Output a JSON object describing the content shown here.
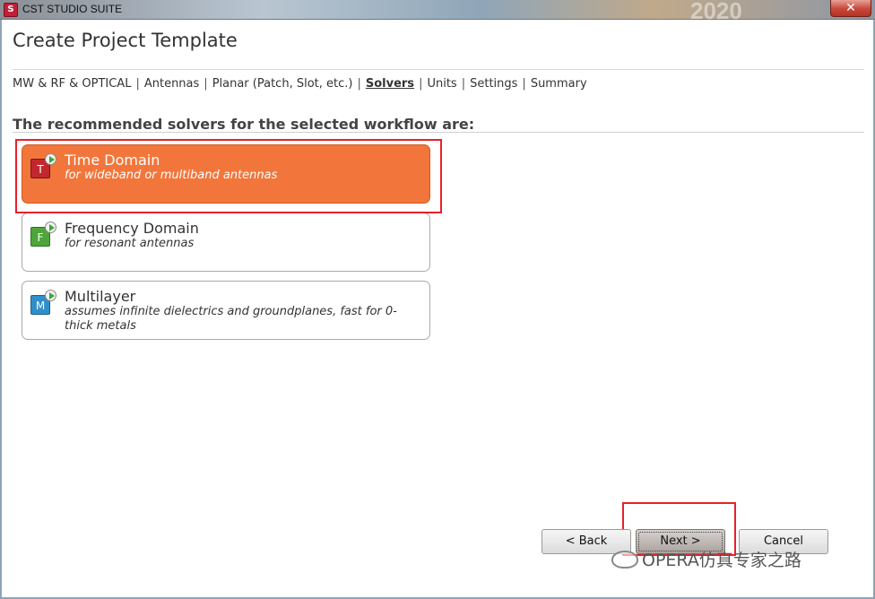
{
  "window": {
    "app_title": "CST STUDIO SUITE",
    "app_icon_glyph": "S",
    "close_glyph": "✕",
    "background_year": "2020"
  },
  "page": {
    "title": "Create Project Template"
  },
  "breadcrumb": {
    "items": [
      {
        "label": "MW & RF & OPTICAL",
        "active": false
      },
      {
        "label": "Antennas",
        "active": false
      },
      {
        "label": "Planar (Patch, Slot, etc.)",
        "active": false
      },
      {
        "label": "Solvers",
        "active": true
      },
      {
        "label": "Units",
        "active": false
      },
      {
        "label": "Settings",
        "active": false
      },
      {
        "label": "Summary",
        "active": false
      }
    ],
    "separator": "|"
  },
  "solvers": {
    "heading": "The recommended solvers for the selected workflow are:",
    "items": [
      {
        "letter": "T",
        "title": "Time Domain",
        "description": "for wideband or multiband antennas",
        "selected": true,
        "icon": "time-domain-solver-icon",
        "color": "#c0282d"
      },
      {
        "letter": "F",
        "title": "Frequency Domain",
        "description": "for resonant antennas",
        "selected": false,
        "icon": "frequency-domain-solver-icon",
        "color": "#4ea53a"
      },
      {
        "letter": "M",
        "title": "Multilayer",
        "description": "assumes infinite dielectrics and groundplanes, fast for 0-thick metals",
        "selected": false,
        "icon": "multilayer-solver-icon",
        "color": "#2f8fc9"
      }
    ]
  },
  "buttons": {
    "back": "< Back",
    "next": "Next >",
    "cancel": "Cancel"
  },
  "watermark": {
    "text": "OPERA仿真专家之路"
  },
  "colors": {
    "selected_card": "#f2763b",
    "highlight": "#e8202a"
  }
}
